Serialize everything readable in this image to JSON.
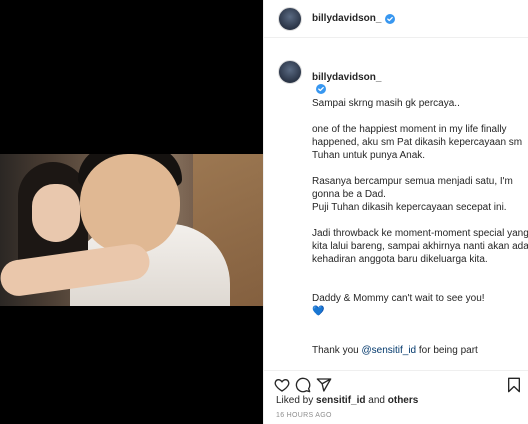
{
  "post": {
    "username": "billydavidson_",
    "verified": true
  },
  "caption": {
    "username": "billydavidson_",
    "first_line": "Sampai skrng masih gk percaya..",
    "paragraphs": [
      "one of the happiest moment in my life finally happened, aku sm Pat dikasih kepercayaan sm Tuhan untuk punya Anak.",
      "Rasanya bercampur semua menjadi satu, I'm gonna be a Dad.\nPuji Tuhan dikasih kepercayaan secepat ini.",
      "Jadi throwback ke moment-moment special yang kita lalui bareng, sampai akhirnya nanti akan ada kehadiran anggota baru dikeluarga kita.",
      "Daddy & Mommy can't wait to see you!"
    ],
    "heart_emoji": "💙",
    "truncated_line_prefix": "Thank you ",
    "truncated_mention": "@sensitif_id",
    "truncated_line_suffix": " for being part"
  },
  "actions": {
    "icons": [
      "heart-icon",
      "comment-icon",
      "share-icon",
      "bookmark-icon"
    ],
    "likes_prefix": "Liked by ",
    "likes_user": "sensitif_id",
    "likes_and": " and ",
    "likes_others": "others",
    "timestamp": "16 HOURS AGO"
  },
  "colors": {
    "verified_badge": "#3897f0",
    "mention": "#00376b",
    "timestamp": "#8e8e8e",
    "heart_emoji": "#1d6fd6"
  }
}
